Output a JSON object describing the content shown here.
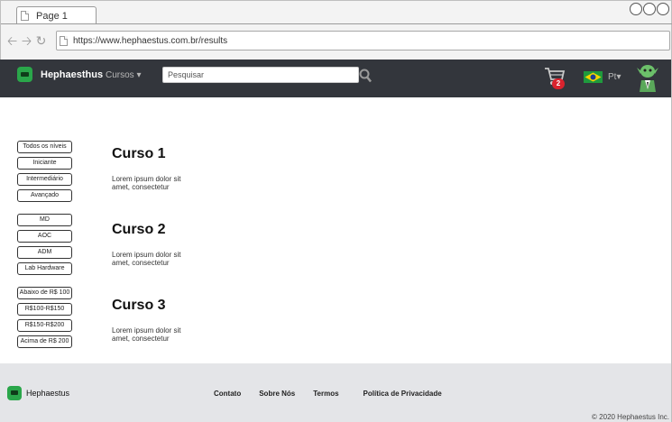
{
  "browser": {
    "tab_title": "Page 1",
    "url": "https://www.hephaestus.com.br/results"
  },
  "navbar": {
    "brand": "Hephaesthus",
    "menu_label": "Cursos",
    "search_placeholder": "Pesquisar",
    "cart_count": "2",
    "language": "Pt"
  },
  "filters": {
    "levels": [
      "Todos os níveis",
      "Iniciante",
      "Intermediário",
      "Avançado"
    ],
    "categories": [
      "MD",
      "AOC",
      "ADM",
      "Lab Hardware"
    ],
    "prices": [
      "Abaixo de R$ 100",
      "R$100-R$150",
      "R$150-R$200",
      "Acima de R$ 200"
    ]
  },
  "courses": [
    {
      "title": "Curso 1",
      "description": "Lorem ipsum dolor sit amet, consectetur"
    },
    {
      "title": "Curso 2",
      "description": "Lorem ipsum dolor sit amet, consectetur"
    },
    {
      "title": "Curso 3",
      "description": "Lorem ipsum dolor sit amet, consectetur"
    }
  ],
  "footer": {
    "brand": "Hephaestus",
    "links": [
      "Contato",
      "Sobre Nós",
      "Termos",
      "Política de Privacidade"
    ],
    "copyright": "© 2020 Hephaestus Inc."
  },
  "colors": {
    "navbar_bg": "#33363c",
    "brand_green": "#2aa64a",
    "badge_red": "#d9232e",
    "footer_bg": "#e4e5e8"
  }
}
